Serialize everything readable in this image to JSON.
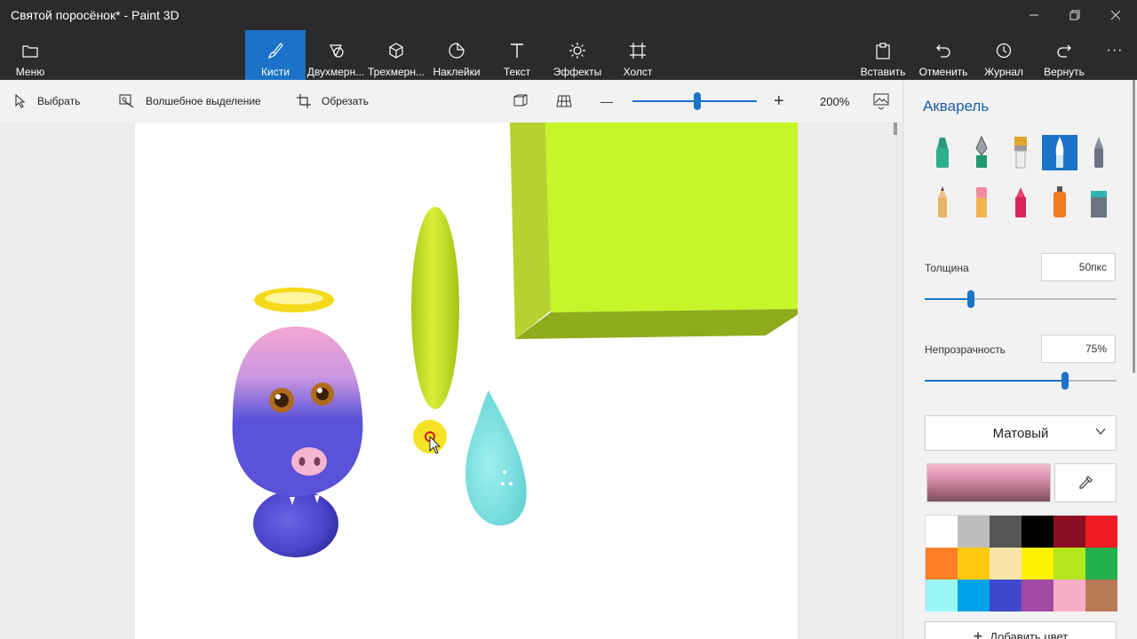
{
  "window": {
    "title": "Святой поросёнок* - Paint 3D",
    "controls": {
      "minimize": "—",
      "restore": "❐",
      "close": "✕"
    }
  },
  "toolbar": {
    "menu_label": "Меню",
    "tools": [
      {
        "label": "Кисти",
        "icon": "brush-icon",
        "active": true
      },
      {
        "label": "Двухмерн...",
        "icon": "2d-shapes-icon",
        "active": false
      },
      {
        "label": "Трехмерн...",
        "icon": "3d-shapes-icon",
        "active": false
      },
      {
        "label": "Наклейки",
        "icon": "stickers-icon",
        "active": false
      },
      {
        "label": "Текст",
        "icon": "text-icon",
        "active": false
      },
      {
        "label": "Эффекты",
        "icon": "effects-icon",
        "active": false
      },
      {
        "label": "Холст",
        "icon": "canvas-icon",
        "active": false
      }
    ],
    "right_actions": [
      {
        "label": "Вставить",
        "icon": "paste-icon"
      },
      {
        "label": "Отменить",
        "icon": "undo-icon"
      },
      {
        "label": "Журнал",
        "icon": "history-icon"
      },
      {
        "label": "Вернуть",
        "icon": "redo-icon"
      }
    ],
    "more": "···"
  },
  "subbar": {
    "select_label": "Выбрать",
    "magic_select_label": "Волшебное выделение",
    "crop_label": "Обрезать",
    "zoom_minus": "—",
    "zoom_plus": "+",
    "zoom_value": "200%",
    "zoom_level": 0.52
  },
  "panel": {
    "title": "Акварель",
    "thickness_label": "Толщина",
    "thickness_value": "50пкс",
    "thickness_level": 0.24,
    "opacity_label": "Непрозрачность",
    "opacity_value": "75%",
    "opacity_level": 0.73,
    "finish_value": "Матовый",
    "add_color_label": "Добавить цвет",
    "add_color_plus": "+",
    "palette": [
      "#ffffff",
      "#bdbdbd",
      "#555555",
      "#000000",
      "#8b0e22",
      "#ee1c24",
      "#ff7f27",
      "#ffc90e",
      "#f9e4a6",
      "#fff200",
      "#b5e61d",
      "#22b14c",
      "#99f7f7",
      "#00a2e8",
      "#3f48cc",
      "#a349a4",
      "#f7afc9",
      "#b97a57"
    ],
    "accent": "#1a73c8"
  }
}
